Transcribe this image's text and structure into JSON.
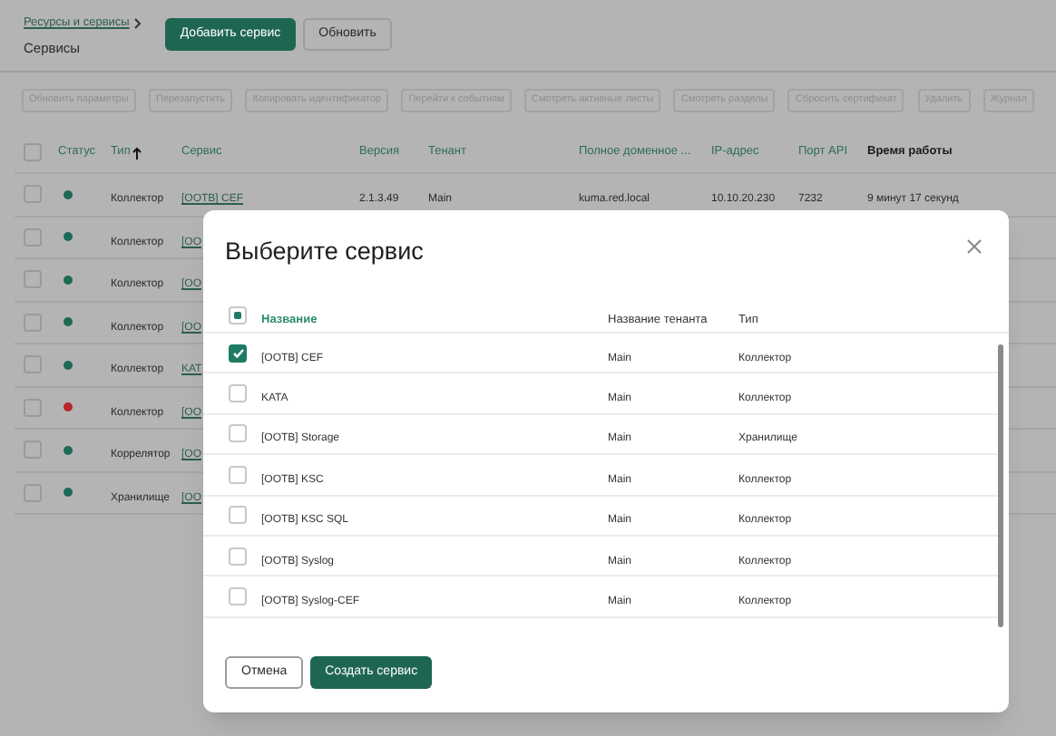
{
  "breadcrumb": {
    "link": "Ресурсы и сервисы",
    "current": "Сервисы"
  },
  "header_buttons": [
    {
      "label": "Добавить сервис",
      "kind": "primary"
    },
    {
      "label": "Обновить",
      "kind": "secondary"
    }
  ],
  "toolbar_buttons": [
    {
      "label": "Обновить параметры",
      "disabled": true
    },
    {
      "label": "Перезапустить",
      "disabled": true
    },
    {
      "label": "Копировать идентификатор",
      "disabled": true
    },
    {
      "label": "Перейти к событиям",
      "disabled": true
    },
    {
      "label": "Смотреть активные листы",
      "disabled": true
    },
    {
      "label": "Смотреть разделы",
      "disabled": true
    },
    {
      "label": "Сбросить сертификат",
      "disabled": true
    },
    {
      "label": "Удалить",
      "disabled": true
    },
    {
      "label": "Журнал",
      "disabled": true
    }
  ],
  "table": {
    "select_all_checked": false,
    "columns": [
      {
        "label": "Статус",
        "sorted": false,
        "emphasized": false
      },
      {
        "label": "Тип",
        "sorted": true,
        "emphasized": false
      },
      {
        "label": "Сервис",
        "sorted": false,
        "emphasized": false
      },
      {
        "label": "Версия",
        "sorted": false,
        "emphasized": false
      },
      {
        "label": "Тенант",
        "sorted": false,
        "emphasized": false
      },
      {
        "label": "Полное доменное ...",
        "sorted": false,
        "emphasized": false
      },
      {
        "label": "IP-адрес",
        "sorted": false,
        "emphasized": false
      },
      {
        "label": "Порт API",
        "sorted": false,
        "emphasized": false
      },
      {
        "label": "Время работы",
        "sorted": false,
        "emphasized": true
      }
    ],
    "rows": [
      {
        "checked": false,
        "cells": [
          {
            "kind": "status",
            "color": "#1d6a56"
          },
          "Коллектор",
          "[OOTB] CEF",
          "2.1.3.49",
          "Main",
          "kuma.red.local",
          "10.10.20.230",
          "7232",
          "9 минут 17 секунд"
        ]
      },
      {
        "checked": false,
        "cells": [
          {
            "kind": "status",
            "color": "#1d6a56"
          },
          "Коллектор",
          "[OO"
        ]
      },
      {
        "checked": false,
        "cells": [
          {
            "kind": "status",
            "color": "#1d6a56"
          },
          "Коллектор",
          "[OO"
        ]
      },
      {
        "checked": false,
        "cells": [
          {
            "kind": "status",
            "color": "#1d6a56"
          },
          "Коллектор",
          "[OO"
        ]
      },
      {
        "checked": false,
        "cells": [
          {
            "kind": "status",
            "color": "#1d6a56"
          },
          "Коллектор",
          "KAT"
        ]
      },
      {
        "checked": false,
        "cells": [
          {
            "kind": "status",
            "color": "#b8272b"
          },
          "Коллектор",
          "[OO"
        ]
      },
      {
        "checked": false,
        "cells": [
          {
            "kind": "status",
            "color": "#1d6a56"
          },
          "Коррелятор",
          "[OO"
        ]
      },
      {
        "checked": false,
        "cells": [
          {
            "kind": "status",
            "color": "#1d6a56"
          },
          "Хранилище",
          "[OO"
        ]
      }
    ]
  },
  "modal": {
    "title": "Выберите сервис",
    "select_all_partial": true,
    "columns": [
      {
        "label": "Название",
        "sorted": true
      },
      {
        "label": "Название тенанта",
        "sorted": false
      },
      {
        "label": "Тип",
        "sorted": false
      }
    ],
    "rows": [
      {
        "checked": true,
        "name": "[OOTB] CEF",
        "tenant": "Main",
        "type": "Коллектор"
      },
      {
        "checked": false,
        "name": "KATA",
        "tenant": "Main",
        "type": "Коллектор"
      },
      {
        "checked": false,
        "name": "[OOTB] Storage",
        "tenant": "Main",
        "type": "Хранилище"
      },
      {
        "checked": false,
        "name": "[OOTB] KSC",
        "tenant": "Main",
        "type": "Коллектор"
      },
      {
        "checked": false,
        "name": "[OOTB] KSC SQL",
        "tenant": "Main",
        "type": "Коллектор"
      },
      {
        "checked": false,
        "name": "[OOTB] Syslog",
        "tenant": "Main",
        "type": "Коллектор"
      },
      {
        "checked": false,
        "name": "[OOTB] Syslog-CEF",
        "tenant": "Main",
        "type": "Коллектор"
      }
    ],
    "buttons": [
      {
        "label": "Отмена",
        "kind": "secondary"
      },
      {
        "label": "Создать сервис",
        "kind": "primary"
      }
    ]
  }
}
